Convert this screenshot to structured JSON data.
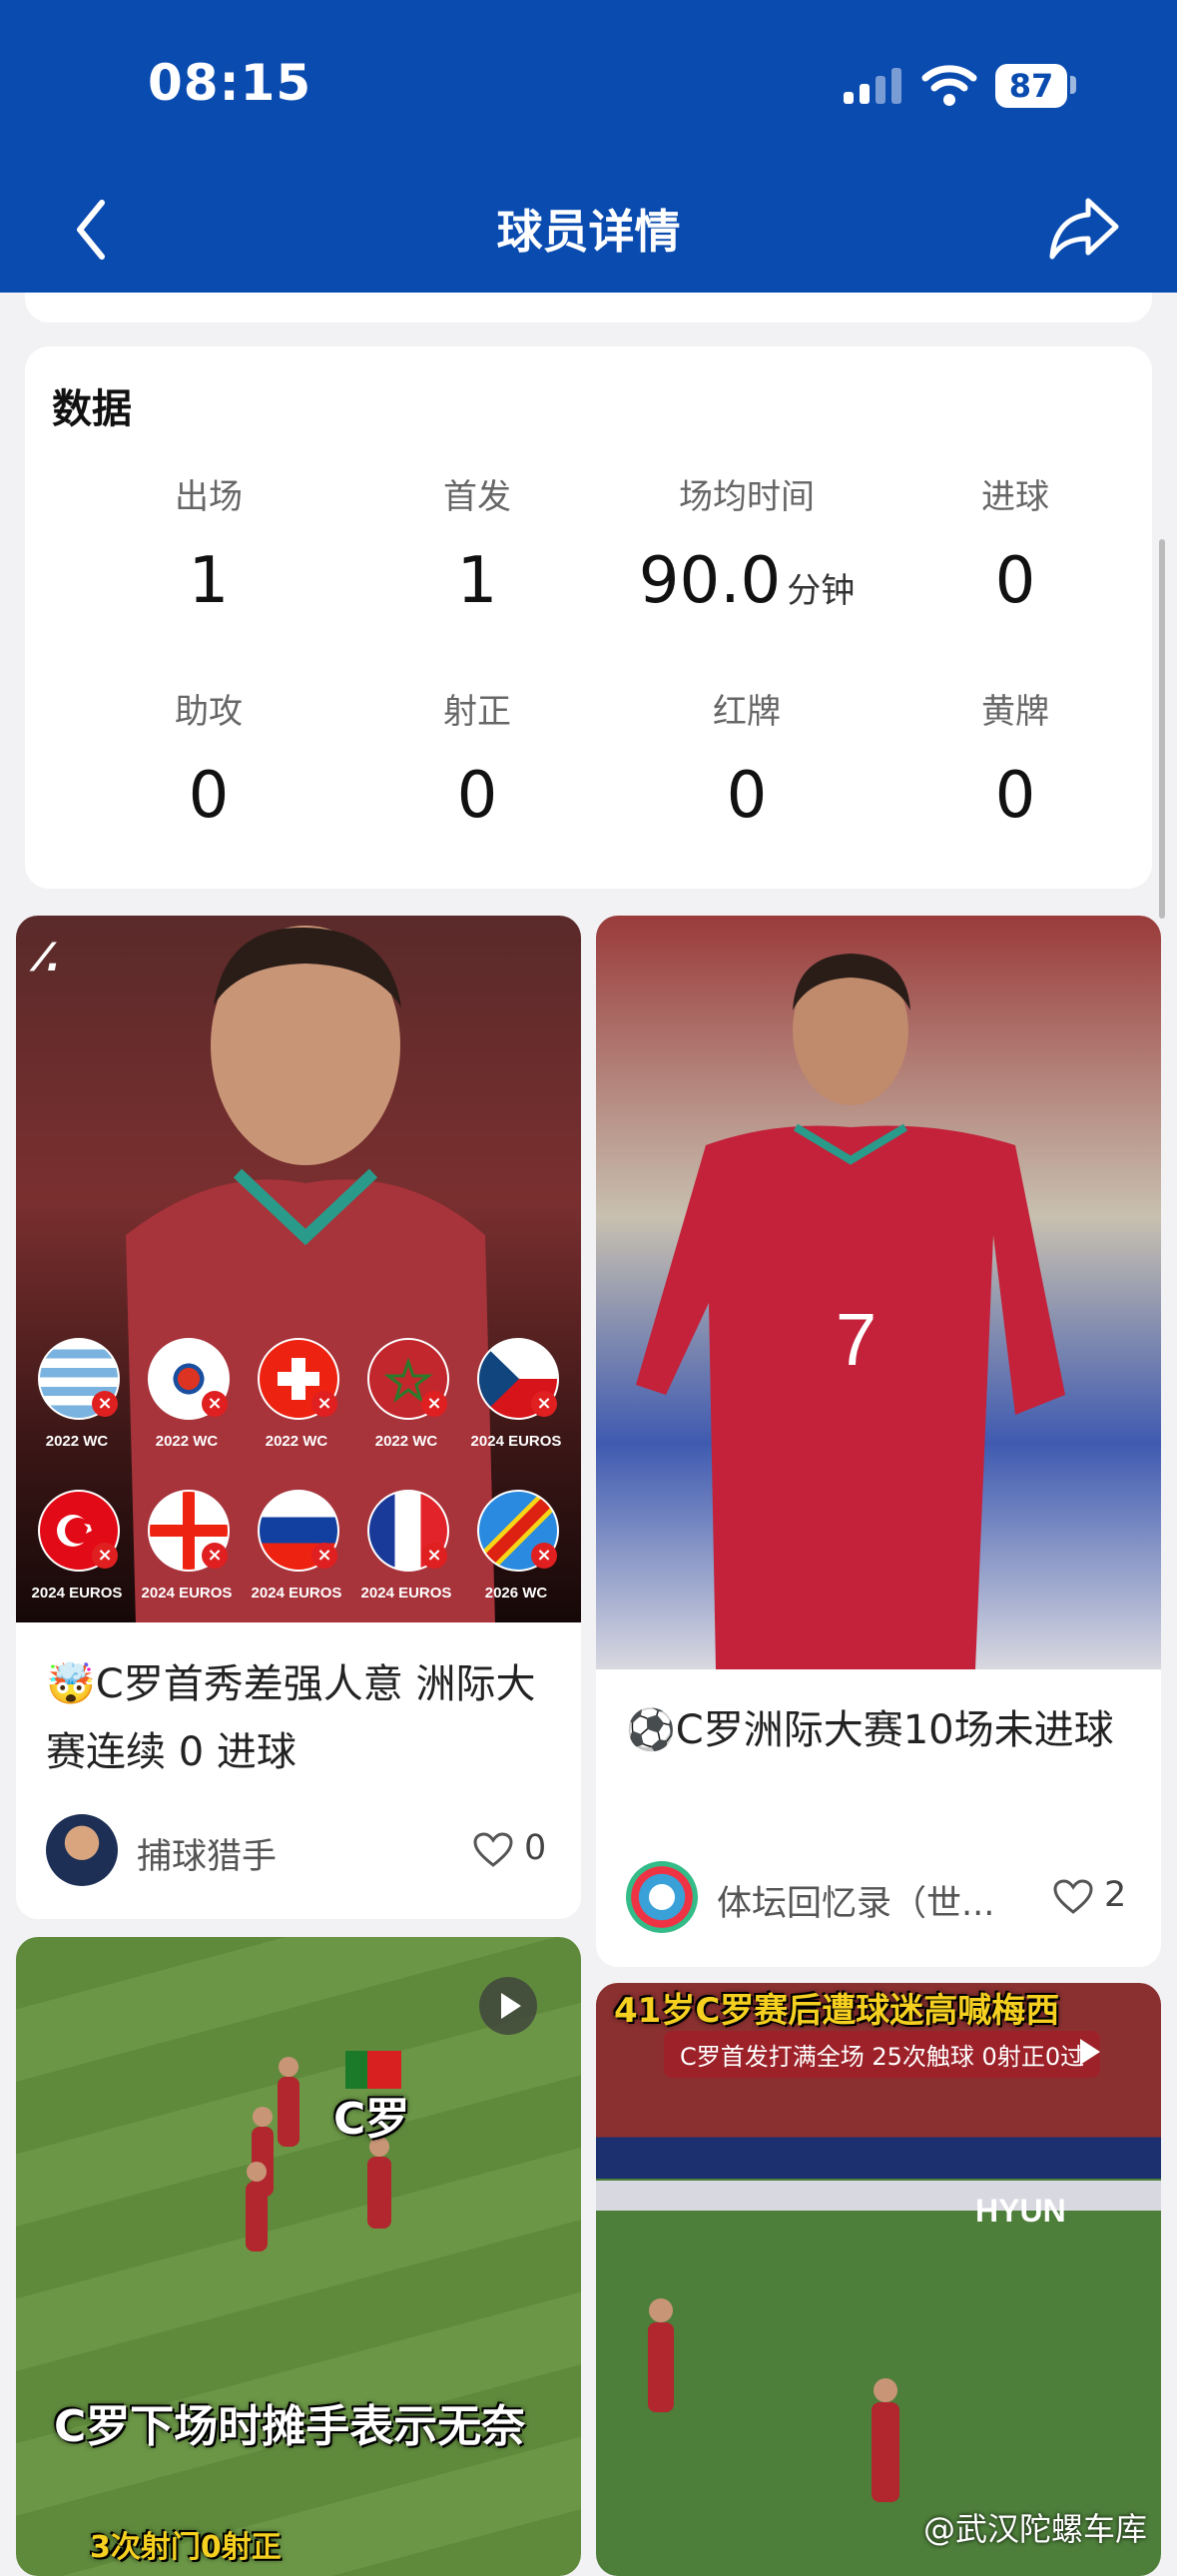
{
  "status_bar": {
    "time": "08:15",
    "battery": "87"
  },
  "header": {
    "title": "球员详情"
  },
  "stats": {
    "title": "数据",
    "items": [
      {
        "label": "出场",
        "value": "1",
        "unit": ""
      },
      {
        "label": "首发",
        "value": "1",
        "unit": ""
      },
      {
        "label": "场均时间",
        "value": "90.0",
        "unit": "分钟"
      },
      {
        "label": "进球",
        "value": "0",
        "unit": ""
      },
      {
        "label": "助攻",
        "value": "0",
        "unit": ""
      },
      {
        "label": "射正",
        "value": "0",
        "unit": ""
      },
      {
        "label": "红牌",
        "value": "0",
        "unit": ""
      },
      {
        "label": "黄牌",
        "value": "0",
        "unit": ""
      }
    ]
  },
  "feed": [
    {
      "title": "🤯C罗首秀差强人意 洲际大赛连续 0 进球",
      "author": "捕球猎手",
      "likes": "0",
      "flags": [
        {
          "caption": "2022 WC"
        },
        {
          "caption": "2022 WC"
        },
        {
          "caption": "2022 WC"
        },
        {
          "caption": "2022 WC"
        },
        {
          "caption": "2024 EUROS"
        },
        {
          "caption": "2024 EUROS"
        },
        {
          "caption": "2024 EUROS"
        },
        {
          "caption": "2024 EUROS"
        },
        {
          "caption": "2024 EUROS"
        },
        {
          "caption": "2026 WC"
        }
      ]
    },
    {
      "title": "⚽C罗洲际大赛10场未进球",
      "author": "体坛回忆录（世...",
      "likes": "2",
      "jersey_number": "7"
    },
    {
      "overlay_label": "C罗",
      "overlay_caption": "C罗下场时摊手表示无奈",
      "overlay_sub": "3次射门0射正"
    },
    {
      "overlay_title": "41岁C罗赛后遭球迷高喊梅西",
      "overlay_sub": "C罗首发打满全场 25次触球 0射正0过",
      "sponsor": "HYUN",
      "watermark": "@武汉陀螺车库"
    }
  ],
  "colors": {
    "brand_blue": "#0a4bb0",
    "jersey_red": "#c3223a",
    "pitch_green": "#5f8a3c"
  }
}
